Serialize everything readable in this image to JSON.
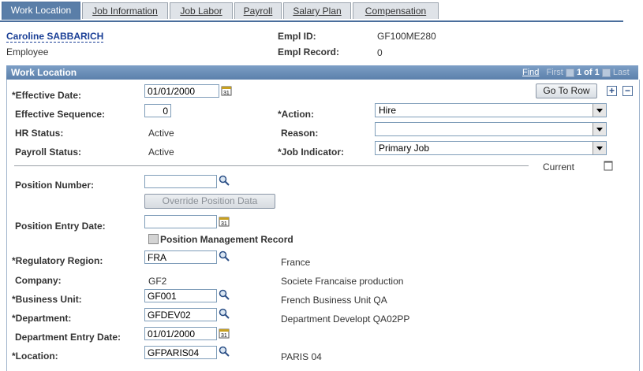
{
  "tabs": [
    {
      "label": "Work Location",
      "active": true
    },
    {
      "label": "Job Information",
      "active": false
    },
    {
      "label": "Job Labor",
      "active": false
    },
    {
      "label": "Payroll",
      "active": false
    },
    {
      "label": "Salary Plan",
      "active": false
    },
    {
      "label": "Compensation",
      "active": false
    }
  ],
  "header": {
    "employee_name": "Caroline SABBARICH",
    "employee_role": "Employee",
    "empl_id_label": "Empl ID:",
    "empl_id_value": "GF100ME280",
    "empl_record_label": "Empl Record:",
    "empl_record_value": "0"
  },
  "group": {
    "title": "Work Location",
    "nav_find": "Find",
    "nav_first": "First",
    "nav_count": "1 of 1",
    "nav_last": "Last",
    "go_to_row": "Go To Row"
  },
  "form": {
    "effective_date_label": "*Effective Date:",
    "effective_date_value": "01/01/2000",
    "effective_seq_label": "Effective Sequence:",
    "effective_seq_value": "0",
    "action_label": "*Action:",
    "action_value": "Hire",
    "hr_status_label": "HR Status:",
    "hr_status_value": "Active",
    "reason_label": "Reason:",
    "reason_value": "",
    "payroll_status_label": "Payroll Status:",
    "payroll_status_value": "Active",
    "job_indicator_label": "*Job Indicator:",
    "job_indicator_value": "Primary Job",
    "current_label": "Current",
    "position_number_label": "Position Number:",
    "position_number_value": "",
    "override_button": "Override Position Data",
    "position_entry_date_label": "Position Entry Date:",
    "position_entry_date_value": "",
    "position_mgmt_label": "Position Management Record",
    "regulatory_region_label": "*Regulatory Region:",
    "regulatory_region_value": "FRA",
    "regulatory_region_desc": "France",
    "company_label": "Company:",
    "company_value": "GF2",
    "company_desc": "Societe Francaise production",
    "business_unit_label": "*Business Unit:",
    "business_unit_value": "GF001",
    "business_unit_desc": "French Business Unit QA",
    "department_label": "*Department:",
    "department_value": "GFDEV02",
    "department_desc": "Department Developt QA02PP",
    "dept_entry_date_label": "Department Entry Date:",
    "dept_entry_date_value": "01/01/2000",
    "location_label": "*Location:",
    "location_value": "GFPARIS04",
    "location_desc": "PARIS 04"
  },
  "colors": {
    "accent": "#5a7ea8",
    "link": "#1a3f96"
  }
}
